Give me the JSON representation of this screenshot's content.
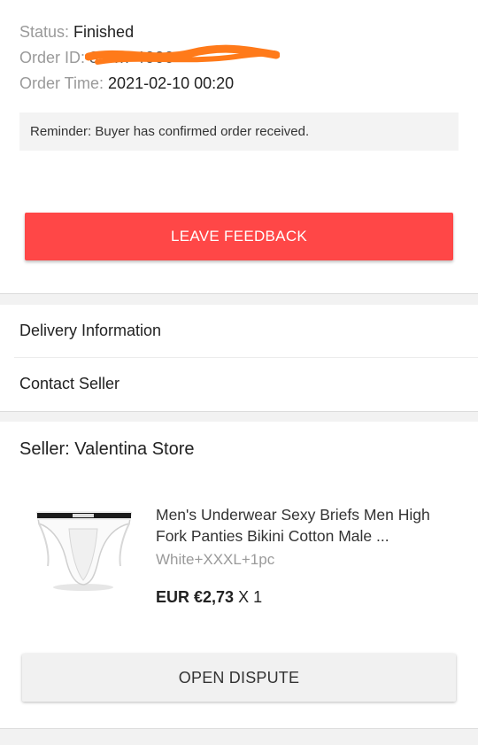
{
  "order": {
    "status_label": "Status:",
    "status_value": "Finished",
    "order_id_label": "Order ID:",
    "order_id_value_partial": "81 ... 4000",
    "order_time_label": "Order Time:",
    "order_time_value": "2021-02-10 00:20",
    "reminder": "Reminder: Buyer has confirmed order received.",
    "leave_feedback_label": "LEAVE FEEDBACK"
  },
  "menu": {
    "delivery_info": "Delivery Information",
    "contact_seller": "Contact Seller"
  },
  "product_section": {
    "seller": "Seller: Valentina Store",
    "product_title": "Men's Underwear Sexy Briefs  Men High Fork Panties Bikini Cotton Male ...",
    "variant": "White+XXXL+1pc",
    "price": "EUR €2,73",
    "quantity": "X 1",
    "open_dispute_label": "OPEN DISPUTE"
  },
  "colors": {
    "accent_red": "#ff4747",
    "redaction_orange": "#ff7a1a",
    "muted_text": "#9a9a9a"
  }
}
